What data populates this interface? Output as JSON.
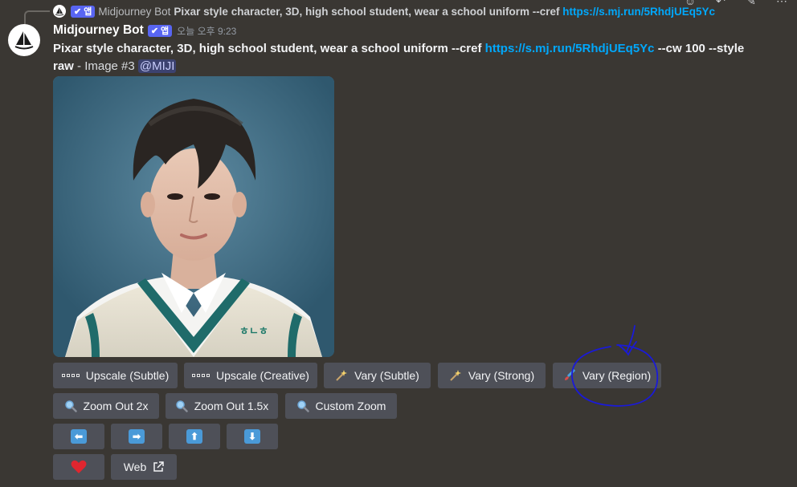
{
  "reply": {
    "bot_name": "Midjourney Bot",
    "badge": "앱",
    "text": "Pixar style character, 3D, high school student, wear a school uniform --cref",
    "link": "https://s.mj.run/5RhdjUEq5Yc"
  },
  "top_icons": [
    "emoji-icon",
    "reply-icon",
    "thread-icon",
    "more-icon"
  ],
  "message": {
    "author": "Midjourney Bot",
    "badge": "앱",
    "timestamp": "오늘 오후 9:23",
    "prompt": "Pixar style character, 3D, high school student, wear a school uniform --cref",
    "link": "https://s.mj.run/5RhdjUEq5Yc",
    "params": "--cw 100 --style raw",
    "suffix": " - Image #3 ",
    "mention": "@MIJI"
  },
  "image": {
    "badge_text": "ㅎㄴㅎ"
  },
  "buttons": {
    "upscale_subtle": "Upscale (Subtle)",
    "upscale_creative": "Upscale (Creative)",
    "vary_subtle": "Vary (Subtle)",
    "vary_strong": "Vary (Strong)",
    "vary_region": "Vary (Region)",
    "zoom_out_2x": "Zoom Out 2x",
    "zoom_out_15x": "Zoom Out 1.5x",
    "custom_zoom": "Custom Zoom",
    "web": "Web"
  },
  "colors": {
    "background": "#3a3733",
    "button": "#4e5058",
    "link": "#00a8fc",
    "badge": "#5865f2",
    "annotation": "#1a1ad8",
    "heart": "#e0262f"
  }
}
